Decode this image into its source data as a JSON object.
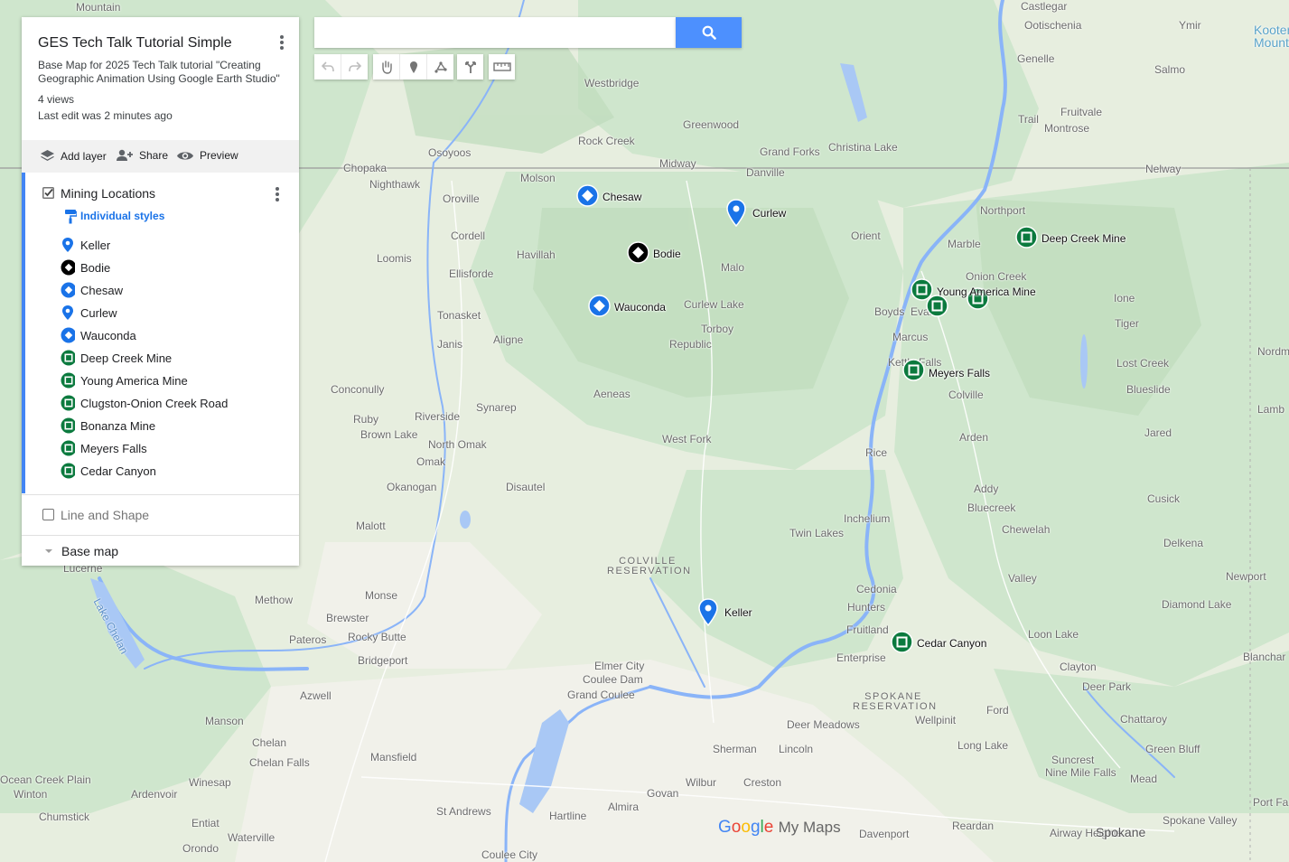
{
  "panel": {
    "title": "GES Tech Talk Tutorial Simple",
    "description": "Base Map for 2025 Tech Talk tutorial \"Creating Geographic Animation Using Google Earth Studio\"",
    "views": "4 views",
    "last_edit": "Last edit was 2 minutes ago",
    "actions": {
      "add_layer": "Add layer",
      "share": "Share",
      "preview": "Preview"
    },
    "layers": [
      {
        "name": "Mining Locations",
        "checked": true,
        "style_label": "Individual styles",
        "items": [
          {
            "label": "Keller",
            "icon": "blue-pin-icon"
          },
          {
            "label": "Bodie",
            "icon": "black-diamond-icon"
          },
          {
            "label": "Chesaw",
            "icon": "blue-diamond-icon"
          },
          {
            "label": "Curlew",
            "icon": "blue-pin-icon"
          },
          {
            "label": "Wauconda",
            "icon": "blue-diamond-icon"
          },
          {
            "label": "Deep Creek Mine",
            "icon": "green-square-icon"
          },
          {
            "label": "Young America Mine",
            "icon": "green-square-icon"
          },
          {
            "label": "Clugston-Onion Creek Road",
            "icon": "green-square-icon"
          },
          {
            "label": "Bonanza Mine",
            "icon": "green-square-icon"
          },
          {
            "label": "Meyers Falls",
            "icon": "green-square-icon"
          },
          {
            "label": "Cedar Canyon",
            "icon": "green-square-icon"
          }
        ]
      },
      {
        "name": "Line and Shape",
        "checked": false
      },
      {
        "name": "Base map"
      }
    ]
  },
  "search": {
    "placeholder": "",
    "value": "",
    "button_icon": "search-icon"
  },
  "tools": [
    "undo-icon",
    "redo-icon",
    "hand-icon",
    "marker-icon",
    "line-icon",
    "directions-icon",
    "ruler-icon"
  ],
  "map": {
    "towns": [
      "Mountain",
      "Castlegar",
      "Ootischenia",
      "Ymir",
      "Kooter",
      "Mount",
      "Genelle",
      "Salmo",
      "Westbridge",
      "Trail",
      "Fruitvale",
      "Montrose",
      "Greenwood",
      "Rock Creek",
      "Grand Forks",
      "Christina Lake",
      "Osoyoos",
      "Midway",
      "Danville",
      "Chopaka",
      "Nelway",
      "Molson",
      "Nighthawk",
      "Oroville",
      "Northport",
      "Cordell",
      "Orient",
      "Marble",
      "Havillah",
      "Loomis",
      "Ellisforde",
      "Malo",
      "Onion Creek",
      "Ione",
      "Tonasket",
      "Curlew Lake",
      "Boyds",
      "Evans",
      "Janis",
      "Torboy",
      "Aligne",
      "Tiger",
      "Marcus",
      "Republic",
      "Kettle Falls",
      "Lost Creek",
      "Nordm",
      "Conconully",
      "Aeneas",
      "Colville",
      "Blueslide",
      "Synarep",
      "Lamb",
      "Ruby",
      "Riverside",
      "Brown Lake",
      "North Omak",
      "Jared",
      "West Fork",
      "Arden",
      "Omak",
      "Rice",
      "Okanogan",
      "Disautel",
      "Addy",
      "Cusick",
      "Bluecreek",
      "Inchelium",
      "Malott",
      "Chewelah",
      "Twin Lakes",
      "Delkena",
      "Valley",
      "Newport",
      "Lucerne",
      "Methow",
      "Monse",
      "Cedonia",
      "Diamond Lake",
      "Brewster",
      "Hunters",
      "Rocky Butte",
      "Pateros",
      "Fruitland",
      "Loon Lake",
      "Bridgeport",
      "Enterprise",
      "Blanchar",
      "Elmer City",
      "Clayton",
      "Coulee Dam",
      "Deer Park",
      "Azwell",
      "Grand Coulee",
      "Chattaroy",
      "Manson",
      "Deer Meadows",
      "Wellpinit",
      "Ford",
      "Chelan",
      "Sherman",
      "Lincoln",
      "Long Lake",
      "Green Bluff",
      "Chelan Falls",
      "Mansfield",
      "Suncrest",
      "Nine Mile Falls",
      "Mead",
      "Winesap",
      "Wilbur",
      "Creston",
      "Ardenvoir",
      "Govan",
      "Almira",
      "Winton",
      "Port Fa",
      "Chumstick",
      "St Andrews",
      "Hartline",
      "Reardan",
      "Spokane Valley",
      "Entiat",
      "Waterville",
      "Davenport",
      "Airway Heights",
      "Spokane",
      "Orondo",
      "Coulee City",
      "Lake Chelan",
      "Ocean Creek Plain"
    ],
    "reservations": [
      "COLVILLE RESERVATION",
      "SPOKANE RESERVATION"
    ],
    "markers": [
      "Chesaw",
      "Curlew",
      "Bodie",
      "Wauconda",
      "Deep Creek Mine",
      "Young America Mine",
      "Meyers Falls",
      "Keller",
      "Cedar Canyon"
    ],
    "logo": {
      "google": "Google",
      "product": "My Maps"
    }
  },
  "colors": {
    "accent": "#4285f4",
    "marker_blue": "#1a73e8",
    "marker_green": "#0b7a3e",
    "marker_black": "#000000",
    "search_button": "#4d90fe"
  }
}
